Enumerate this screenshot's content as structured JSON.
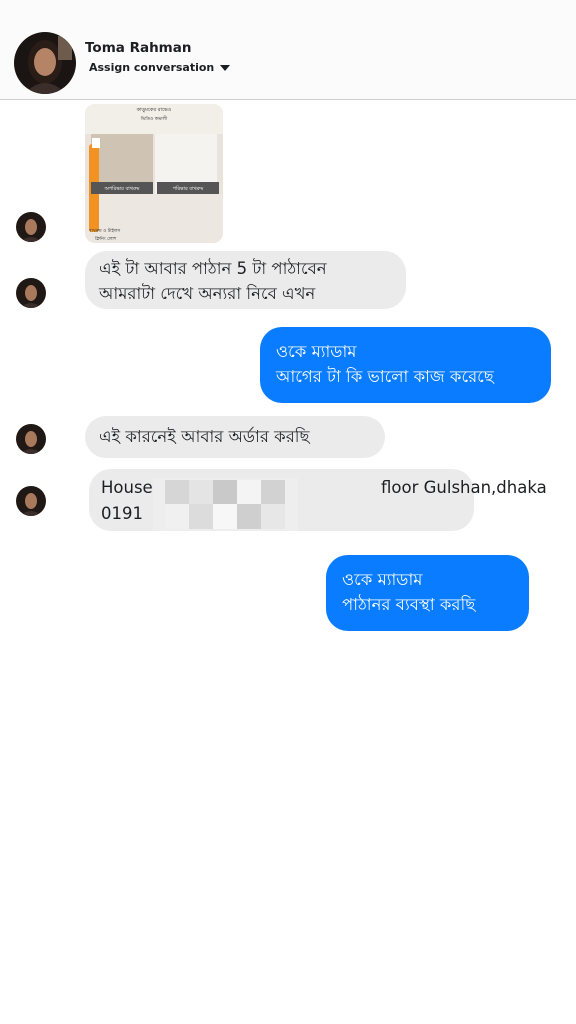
{
  "header": {
    "contact_name": "Toma Rahman",
    "assign_label": "Assign conversation",
    "caret_icon": "caret-down-icon"
  },
  "colors": {
    "outgoing_bubble": "#0a7cff",
    "incoming_bubble": "#ebebeb",
    "background": "#ffffff"
  },
  "messages": [
    {
      "direction": "incoming",
      "type": "image",
      "overlay_texts": [
        "কাড়ুমকের রাভেও",
        "ভিডিও কভালী",
        "অপরিষ্কার বাথরুম",
        "পরিষ্কার বাথরুম",
        "বাথরুম ও টাইলস",
        "ক্লিনিং লোশ"
      ]
    },
    {
      "direction": "incoming",
      "lines": [
        "এই টা আবার পাঠান 5 টা পাঠাবেন",
        "আমরাটা দেখে অন্যরা নিবে এখন"
      ]
    },
    {
      "direction": "outgoing",
      "lines": [
        "ওকে ম্যাডাম",
        "আগের টা কি ভালো কাজ করেছে"
      ]
    },
    {
      "direction": "incoming",
      "lines": [
        "এই কারনেই আবার অর্ডার করছি"
      ]
    },
    {
      "direction": "incoming",
      "lines": [
        "House",
        "floor Gulshan,dhaka",
        "0191"
      ]
    },
    {
      "direction": "outgoing",
      "lines": [
        "ওকে ম্যাডাম",
        "পাঠানর ব্যবস্থা করছি"
      ]
    }
  ]
}
